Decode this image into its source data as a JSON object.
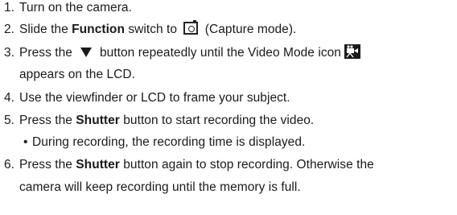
{
  "steps": [
    {
      "num": "1.",
      "text": "Turn on the camera."
    },
    {
      "num": "2.",
      "pre": "Slide the ",
      "bold": "Function",
      "mid": " switch to ",
      "post": " (Capture mode)."
    },
    {
      "num": "3.",
      "pre": "Press the",
      "mid": "button repeatedly until the Video Mode icon",
      "cont": "appears on the LCD."
    },
    {
      "num": "4.",
      "text": "Use the viewfinder or LCD to frame your subject."
    },
    {
      "num": "5.",
      "pre": "Press the ",
      "bold": "Shutter",
      "post": " button to start recording the video."
    },
    {
      "num": "6.",
      "pre": "Press the ",
      "bold": "Shutter",
      "post": " button again to stop recording. Otherwise the",
      "cont": "camera will keep recording until  the memory is full."
    }
  ],
  "bullet": {
    "symbol": "•",
    "text": "During recording, the recording time is displayed."
  },
  "icons": {
    "capture_mode": "camera-icon",
    "down_button": "down-triangle-icon",
    "video_mode": "video-mode-icon"
  }
}
